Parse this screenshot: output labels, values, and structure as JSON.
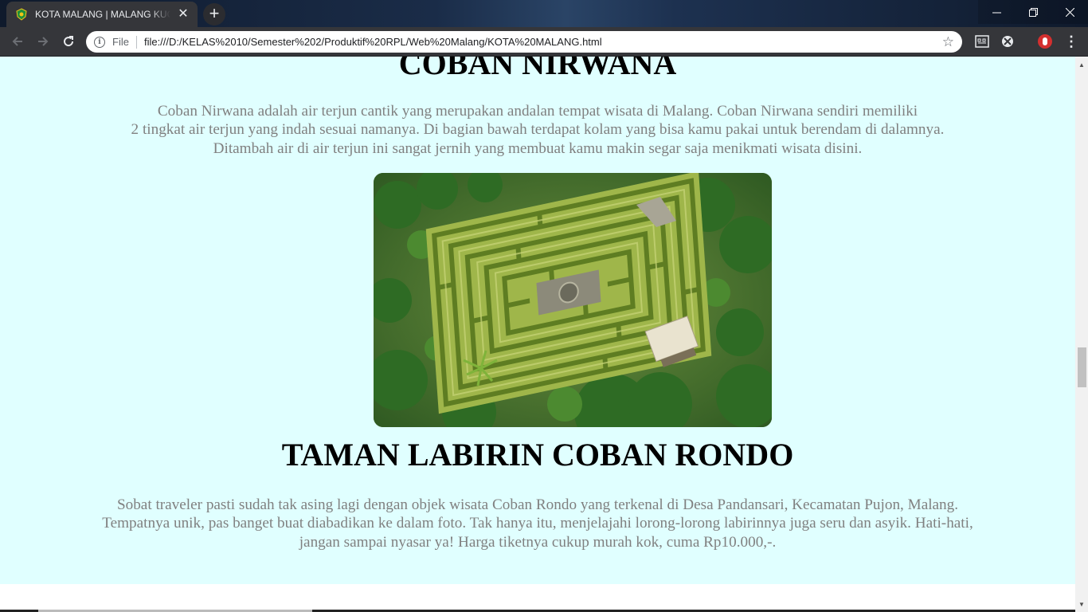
{
  "browser": {
    "tab_title": "KOTA MALANG | MALANG KUCECWARA",
    "address_scheme": "File",
    "url": "file:///D:/KELAS%2010/Semester%202/Produktif%20RPL/Web%20Malang/KOTA%20MALANG.html",
    "icons": [
      "favicon-emblem",
      "close-icon",
      "plus-icon",
      "minimize-icon",
      "maximize-icon",
      "window-close-icon",
      "back-arrow-icon",
      "forward-arrow-icon",
      "reload-icon",
      "info-icon",
      "star-icon",
      "extension-icon",
      "menu-dots-icon"
    ]
  },
  "page": {
    "background": "#e0ffff",
    "text_color": "#808080",
    "section1": {
      "heading": "COBAN NIRWANA",
      "lines": [
        "Coban Nirwana adalah air terjun cantik yang merupakan andalan tempat wisata di Malang. Coban Nirwana sendiri memiliki",
        "2 tingkat air terjun yang indah sesuai namanya. Di bagian bawah terdapat kolam yang bisa kamu pakai untuk berendam di dalamnya.",
        "Ditambah air di air terjun ini sangat jernih yang membuat kamu makin segar saja menikmati wisata disini."
      ]
    },
    "section2": {
      "image": "aerial-hedge-maze-photo",
      "heading": "TAMAN LABIRIN COBAN RONDO",
      "lines": [
        "Sobat traveler pasti sudah tak asing lagi dengan objek wisata Coban Rondo yang terkenal di Desa Pandansari, Kecamatan Pujon, Malang.",
        "Tempatnya unik, pas banget buat diabadikan ke dalam foto. Tak hanya itu, menjelajahi lorong-lorong labirinnya juga seru dan asyik. Hati-hati,",
        "jangan sampai nyasar ya! Harga tiketnya cukup murah kok, cuma Rp10.000,-."
      ]
    }
  }
}
